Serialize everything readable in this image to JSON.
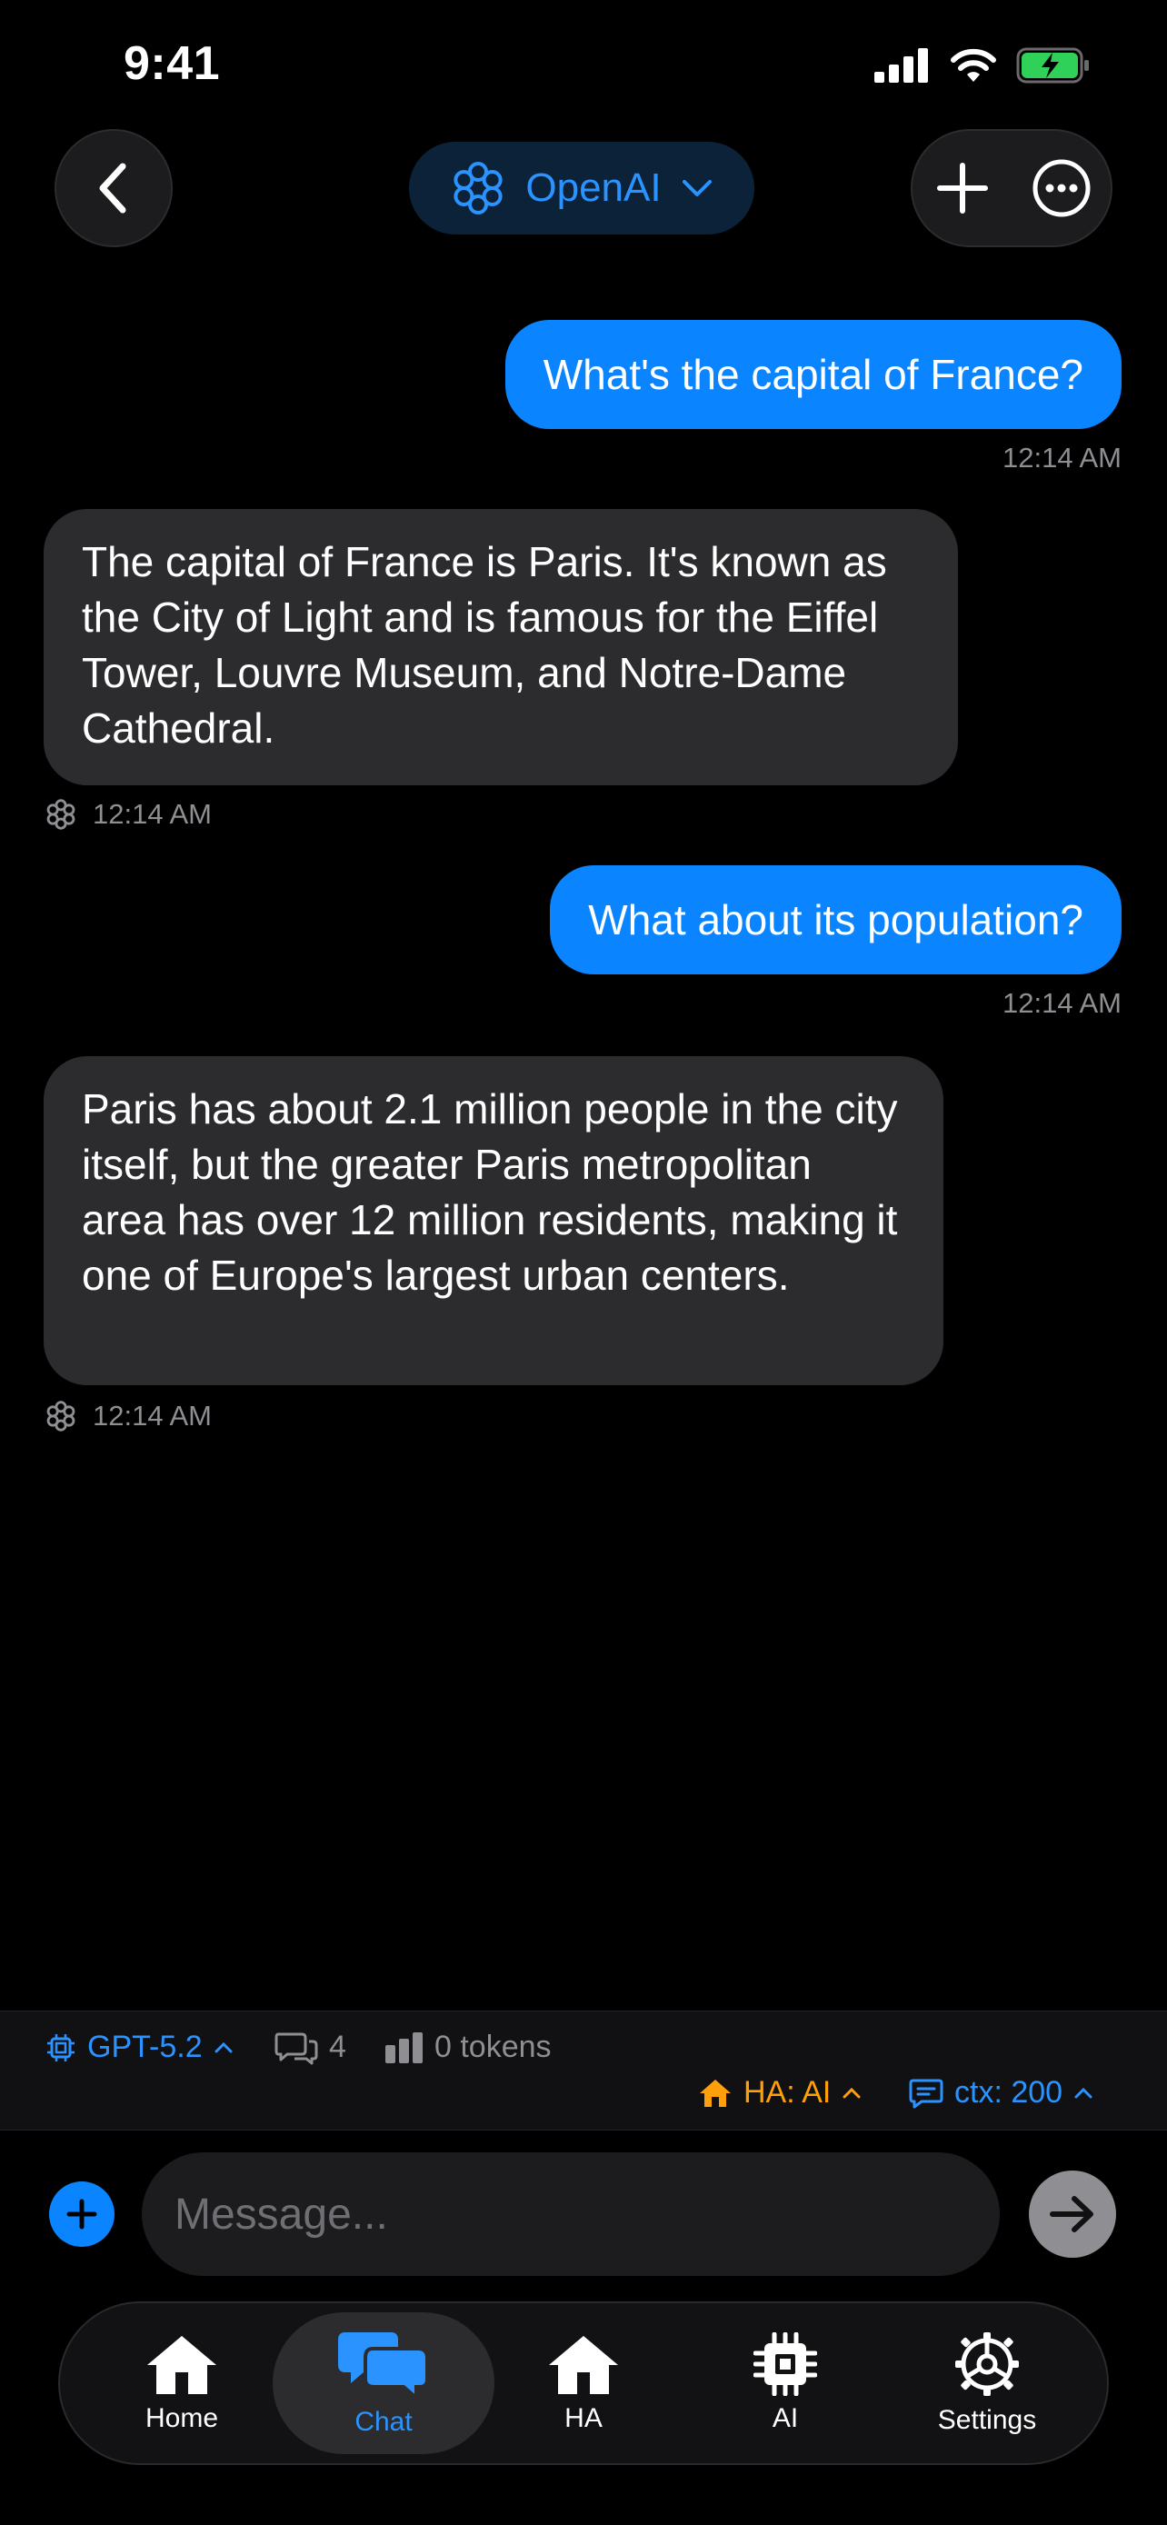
{
  "status_bar": {
    "time": "9:41"
  },
  "header": {
    "model_name": "OpenAI"
  },
  "messages": [
    {
      "role": "user",
      "text": "What's the capital of France?",
      "time": "12:14 AM"
    },
    {
      "role": "assistant",
      "text": "The capital of France is Paris. It's known as the City of Light and is famous for the Eiffel Tower, Louvre Museum, and Notre-Dame Cathedral.",
      "time": "12:14 AM"
    },
    {
      "role": "user",
      "text": "What about its population?",
      "time": "12:14 AM"
    },
    {
      "role": "assistant",
      "text": "Paris has about 2.1 million people in the city itself, but the greater Paris metropolitan area has over 12 million residents, making it one of Europe's largest urban centers.",
      "time": "12:14 AM"
    }
  ],
  "stats": {
    "model": "GPT-5.2",
    "message_count": "4",
    "tokens": "0 tokens",
    "ha_mode": "HA: AI",
    "context": "ctx: 200"
  },
  "composer": {
    "placeholder": "Message..."
  },
  "tabs": [
    {
      "label": "Home",
      "icon": "house-icon"
    },
    {
      "label": "Chat",
      "icon": "chat-bubbles-icon",
      "active": true
    },
    {
      "label": "HA",
      "icon": "house-icon"
    },
    {
      "label": "AI",
      "icon": "chip-icon"
    },
    {
      "label": "Settings",
      "icon": "gear-icon"
    }
  ],
  "colors": {
    "accent": "#0a84ff",
    "ha_orange": "#ff9f0a",
    "bubble_gray": "#2c2c2e"
  }
}
